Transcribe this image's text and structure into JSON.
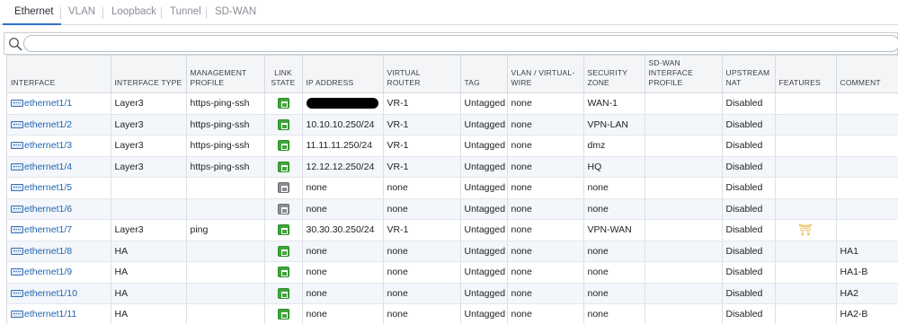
{
  "tabs": [
    {
      "label": "Ethernet",
      "active": true
    },
    {
      "label": "VLAN",
      "active": false
    },
    {
      "label": "Loopback",
      "active": false
    },
    {
      "label": "Tunnel",
      "active": false
    },
    {
      "label": "SD-WAN",
      "active": false
    }
  ],
  "search": {
    "placeholder": "",
    "value": "",
    "icon": "search-icon"
  },
  "columns": {
    "interface": "INTERFACE",
    "interface_type": "INTERFACE TYPE",
    "management_profile_1": "MANAGEMENT",
    "management_profile_2": "PROFILE",
    "link_state_1": "LINK",
    "link_state_2": "STATE",
    "ip_address": "IP ADDRESS",
    "virtual_router_1": "VIRTUAL",
    "virtual_router_2": "ROUTER",
    "tag": "TAG",
    "vlan_vwire_1": "VLAN / VIRTUAL-",
    "vlan_vwire_2": "WIRE",
    "security_zone_1": "SECURITY",
    "security_zone_2": "ZONE",
    "sdwan_profile_1": "SD-WAN",
    "sdwan_profile_2": "INTERFACE",
    "sdwan_profile_3": "PROFILE",
    "upstream_nat_1": "UPSTREAM",
    "upstream_nat_2": "NAT",
    "features": "FEATURES",
    "comment": "COMMENT"
  },
  "rows": [
    {
      "interface": "ethernet1/1",
      "type": "Layer3",
      "profile": "https-ping-ssh",
      "link": "up",
      "ip": "",
      "ip_redacted": true,
      "vr": "VR-1",
      "tag": "Untagged",
      "vlan": "none",
      "zone": "WAN-1",
      "sdwan": "",
      "nat": "Disabled",
      "features": "",
      "comment": ""
    },
    {
      "interface": "ethernet1/2",
      "type": "Layer3",
      "profile": "https-ping-ssh",
      "link": "up",
      "ip": "10.10.10.250/24",
      "ip_redacted": false,
      "vr": "VR-1",
      "tag": "Untagged",
      "vlan": "none",
      "zone": "VPN-LAN",
      "sdwan": "",
      "nat": "Disabled",
      "features": "",
      "comment": ""
    },
    {
      "interface": "ethernet1/3",
      "type": "Layer3",
      "profile": "https-ping-ssh",
      "link": "up",
      "ip": "11.11.11.250/24",
      "ip_redacted": false,
      "vr": "VR-1",
      "tag": "Untagged",
      "vlan": "none",
      "zone": "dmz",
      "sdwan": "",
      "nat": "Disabled",
      "features": "",
      "comment": ""
    },
    {
      "interface": "ethernet1/4",
      "type": "Layer3",
      "profile": "https-ping-ssh",
      "link": "up",
      "ip": "12.12.12.250/24",
      "ip_redacted": false,
      "vr": "VR-1",
      "tag": "Untagged",
      "vlan": "none",
      "zone": "HQ",
      "sdwan": "",
      "nat": "Disabled",
      "features": "",
      "comment": ""
    },
    {
      "interface": "ethernet1/5",
      "type": "",
      "profile": "",
      "link": "down",
      "ip": "none",
      "ip_redacted": false,
      "vr": "none",
      "tag": "Untagged",
      "vlan": "none",
      "zone": "none",
      "sdwan": "",
      "nat": "Disabled",
      "features": "",
      "comment": ""
    },
    {
      "interface": "ethernet1/6",
      "type": "",
      "profile": "",
      "link": "down",
      "ip": "none",
      "ip_redacted": false,
      "vr": "none",
      "tag": "Untagged",
      "vlan": "none",
      "zone": "none",
      "sdwan": "",
      "nat": "Disabled",
      "features": "",
      "comment": ""
    },
    {
      "interface": "ethernet1/7",
      "type": "Layer3",
      "profile": "ping",
      "link": "up",
      "ip": "30.30.30.250/24",
      "ip_redacted": false,
      "vr": "VR-1",
      "tag": "Untagged",
      "vlan": "none",
      "zone": "VPN-WAN",
      "sdwan": "",
      "nat": "Disabled",
      "features": "feature-icon",
      "comment": ""
    },
    {
      "interface": "ethernet1/8",
      "type": "HA",
      "profile": "",
      "link": "up",
      "ip": "none",
      "ip_redacted": false,
      "vr": "none",
      "tag": "Untagged",
      "vlan": "none",
      "zone": "none",
      "sdwan": "",
      "nat": "Disabled",
      "features": "",
      "comment": "HA1"
    },
    {
      "interface": "ethernet1/9",
      "type": "HA",
      "profile": "",
      "link": "up",
      "ip": "none",
      "ip_redacted": false,
      "vr": "none",
      "tag": "Untagged",
      "vlan": "none",
      "zone": "none",
      "sdwan": "",
      "nat": "Disabled",
      "features": "",
      "comment": "HA1-B"
    },
    {
      "interface": "ethernet1/10",
      "type": "HA",
      "profile": "",
      "link": "up",
      "ip": "none",
      "ip_redacted": false,
      "vr": "none",
      "tag": "Untagged",
      "vlan": "none",
      "zone": "none",
      "sdwan": "",
      "nat": "Disabled",
      "features": "",
      "comment": "HA2"
    },
    {
      "interface": "ethernet1/11",
      "type": "HA",
      "profile": "",
      "link": "up",
      "ip": "none",
      "ip_redacted": false,
      "vr": "none",
      "tag": "Untagged",
      "vlan": "none",
      "zone": "none",
      "sdwan": "",
      "nat": "Disabled",
      "features": "",
      "comment": "HA2-B"
    }
  ],
  "colors": {
    "accent": "#2f73c4",
    "link": "#1f64b0",
    "link_up": "#3fa63a",
    "link_down": "#8a8d91",
    "feature": "#e7a019"
  }
}
